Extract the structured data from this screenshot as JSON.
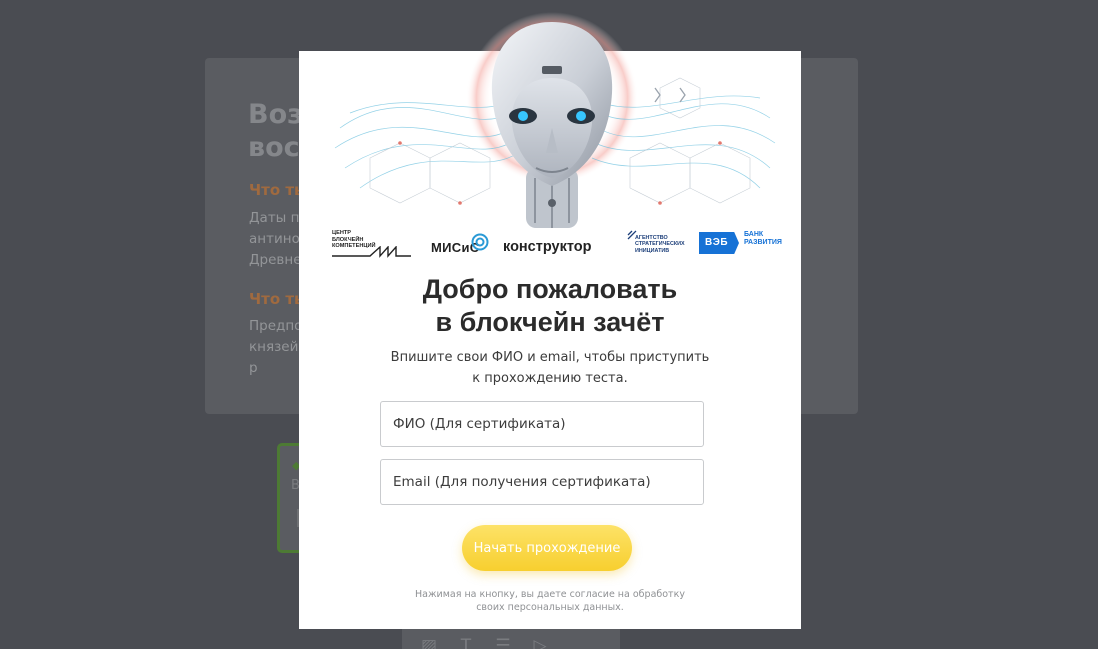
{
  "background_page": {
    "title": "Возм\nвост",
    "section1_heading": "Что ты",
    "section1_text": "Даты пр\nантинор\nДревнер",
    "section2_heading": "Что ты",
    "section2_text": "Предпо\nкнязей, р",
    "quiz_label": "В"
  },
  "colors": {
    "overlay": "#4a4c52",
    "accent_button": "#f7cf2f",
    "veb_blue": "#1672d6"
  },
  "modal": {
    "logos": {
      "center": "ЦЕНТР\nБЛОКЧЕЙН\nКОМПЕТЕНЦИЙ",
      "misis": "МИСиС",
      "konstruktor": "конструктор",
      "asi": "АГЕНТСТВО\nСТРАТЕГИЧЕСКИХ\nИНИЦИАТИВ",
      "veb": "ВЭБ",
      "veb_bank": "БАНК\nРАЗВИТИЯ"
    },
    "heading": "Добро пожаловать\nв блокчейн зачёт",
    "description": "Впишите свои ФИО и email, чтобы приступить\nк прохождению теста.",
    "form": {
      "name_placeholder": "ФИО (Для сертификата)",
      "email_placeholder": "Email (Для получения сертификата)",
      "submit_label": "Начать прохождение"
    },
    "consent": "Нажимая на кнопку, вы даете согласие на обработку\nсвоих персональных данных."
  },
  "toolbar_icons": [
    "image-icon",
    "text-icon",
    "list-icon",
    "video-icon"
  ]
}
